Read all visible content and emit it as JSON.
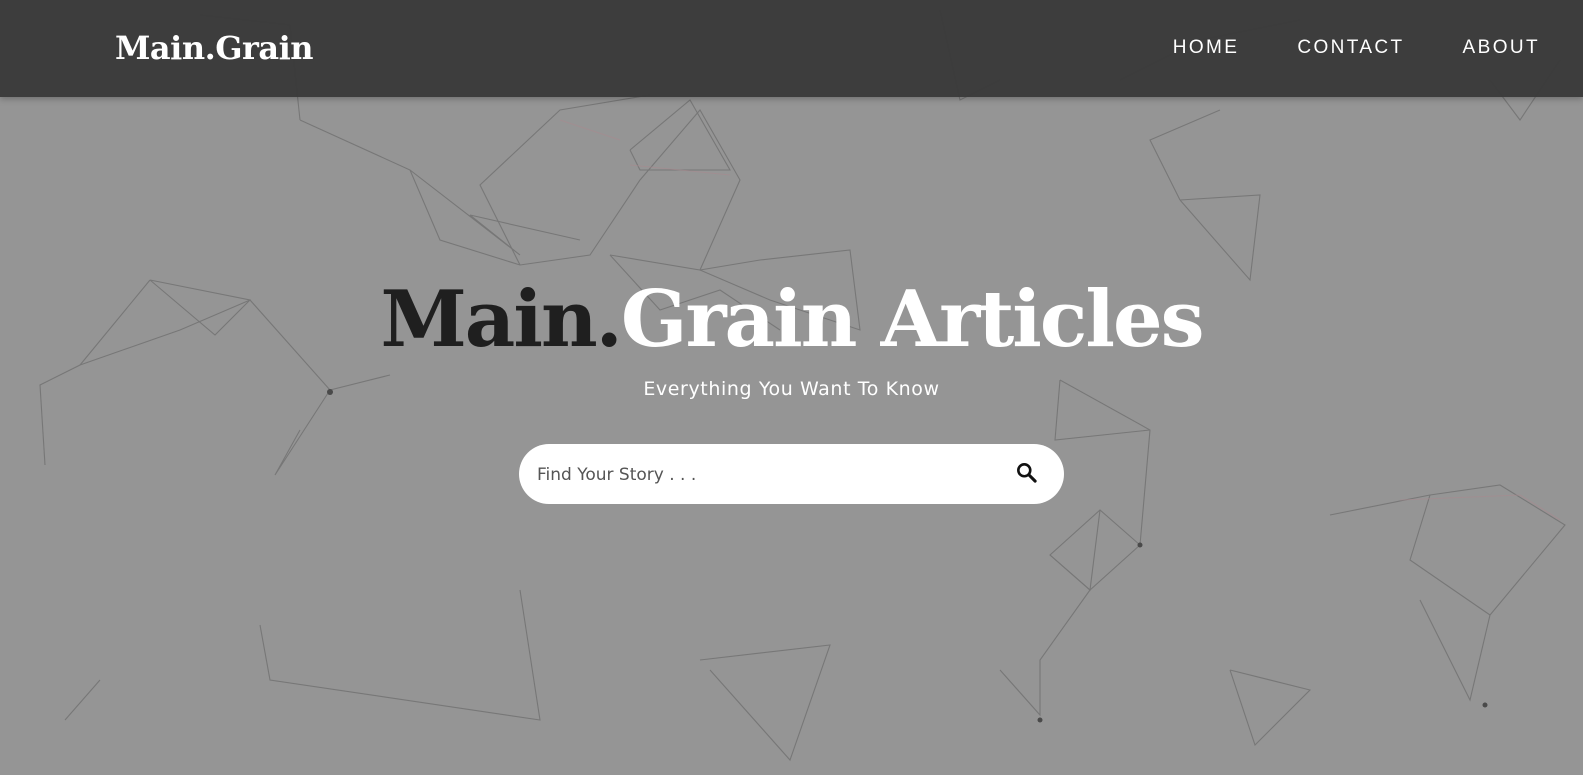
{
  "navbar": {
    "brand": "Main.Grain",
    "links": [
      "HOME",
      "CONTACT",
      "ABOUT"
    ]
  },
  "hero": {
    "title_dark": "Main.",
    "title_light": "Grain Articles",
    "subtitle": "Everything You Want To Know"
  },
  "search": {
    "placeholder": "Find Your Story . . .",
    "value": "",
    "icon": "search-icon"
  },
  "colors": {
    "navbar_bg": "#3a3a3a",
    "hero_bg": "#959595",
    "title_dark": "#1f1f1f",
    "title_light": "#ffffff"
  }
}
